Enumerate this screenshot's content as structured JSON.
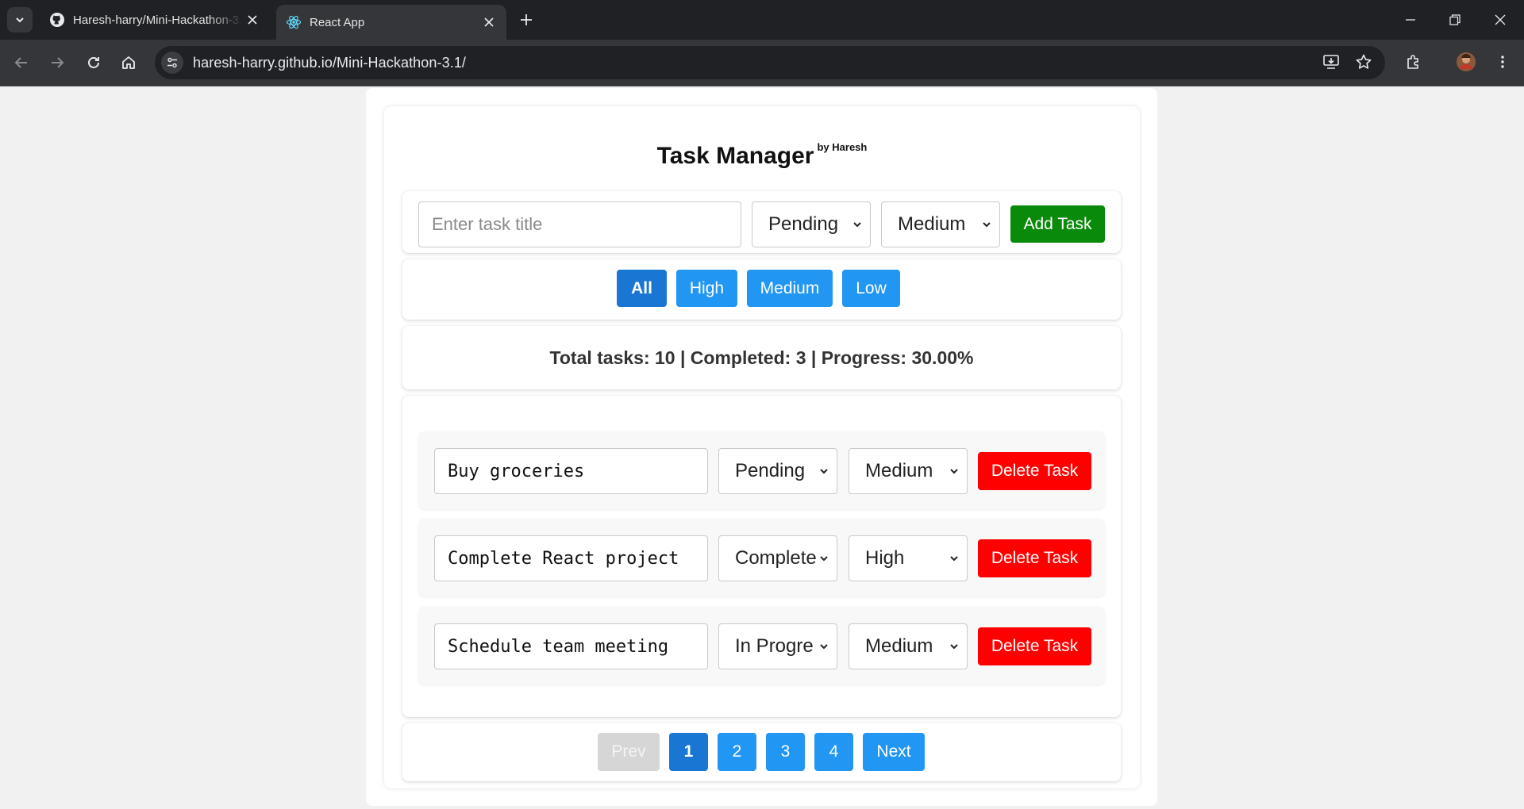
{
  "browser": {
    "tabs": [
      {
        "title": "Haresh-harry/Mini-Hackathon-3.1",
        "icon": "github-icon",
        "active": false
      },
      {
        "title": "React App",
        "icon": "react-icon",
        "active": true
      }
    ],
    "url": "haresh-harry.github.io/Mini-Hackathon-3.1/"
  },
  "app": {
    "title": "Task Manager",
    "byline": "by Haresh",
    "new_task": {
      "placeholder": "Enter task title",
      "status": "Pending",
      "priority": "Medium",
      "add_label": "Add Task"
    },
    "filters": [
      {
        "label": "All",
        "active": true
      },
      {
        "label": "High",
        "active": false
      },
      {
        "label": "Medium",
        "active": false
      },
      {
        "label": "Low",
        "active": false
      }
    ],
    "stats": "Total tasks: 10 | Completed: 3 | Progress: 30.00%",
    "tasks": [
      {
        "title": "Buy groceries",
        "status": "Pending",
        "priority": "Medium",
        "delete_label": "Delete Task"
      },
      {
        "title": "Complete React project",
        "status": "Complete",
        "priority": "High",
        "delete_label": "Delete Task"
      },
      {
        "title": "Schedule team meeting",
        "status": "In Progre",
        "priority": "Medium",
        "delete_label": "Delete Task"
      }
    ],
    "pagination": {
      "prev": "Prev",
      "pages": [
        "1",
        "2",
        "3",
        "4"
      ],
      "current": "1",
      "next": "Next"
    }
  },
  "colors": {
    "add_button": "#0a8a0a",
    "delete_button": "#ff0000",
    "filter_button": "#2196f3",
    "active_button": "#1976d2"
  }
}
